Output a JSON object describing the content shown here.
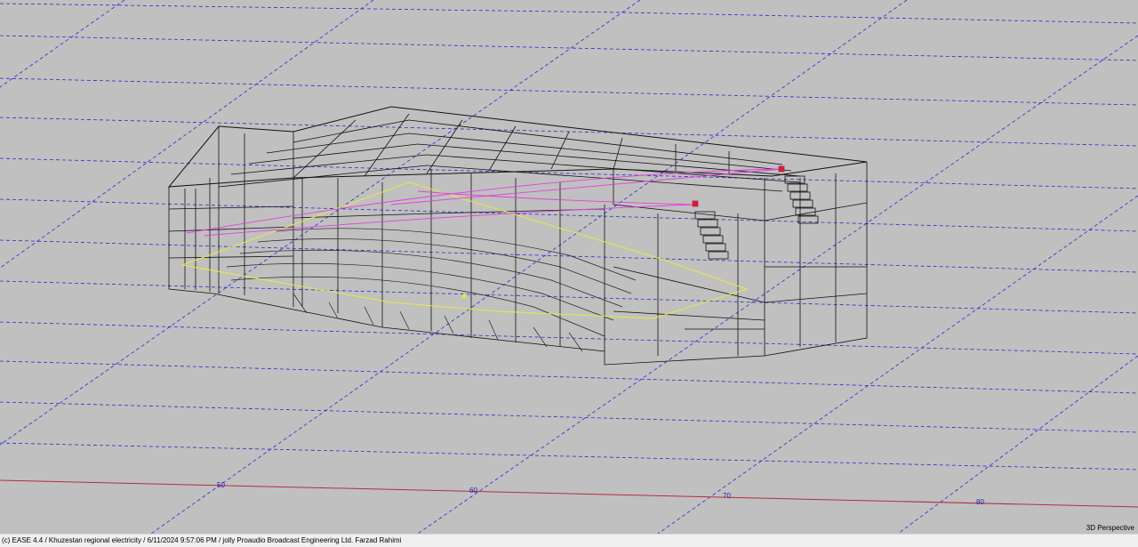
{
  "viewport": {
    "mode_label": "3D Perspective",
    "axis_ticks": [
      "50",
      "60",
      "70",
      "80"
    ]
  },
  "statusbar": {
    "text": "(c) EASE 4.4  / Khuzestan regional electricity  / 6/11/2024 9:57:06 PM / jolly Proaudio Broadcast Engineering Ltd. Farzad Rahimi"
  },
  "colors": {
    "background": "#c0c0c0",
    "grid": "#2a2ad0",
    "axis_line": "#b03040",
    "wireframe": "#000000",
    "audience_area": "#e8e840",
    "speaker_aim": "#e040e0",
    "speaker": "#cc2040"
  }
}
